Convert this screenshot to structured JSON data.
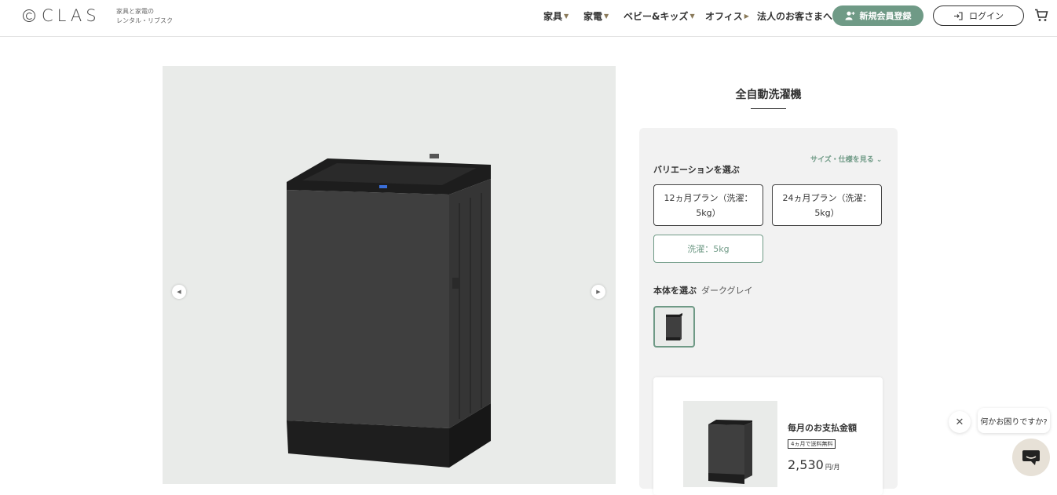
{
  "header": {
    "logo_text": "CLAS",
    "tagline_line1": "家具と家電の",
    "tagline_line2": "レンタル・リブスク",
    "nav": [
      {
        "label": "家具"
      },
      {
        "label": "家電"
      },
      {
        "label": "ベビー&キッズ"
      },
      {
        "label": "オフィス"
      },
      {
        "label": "法人のお客さまへ"
      }
    ],
    "register_label": "新規会員登録",
    "login_label": "ログイン"
  },
  "product": {
    "title": "全自動洗濯機",
    "spec_link": "サイズ・仕様を見る",
    "variation_label": "バリエーションを選ぶ",
    "variants": [
      {
        "label": "12ヵ月プラン（洗濯：5kg）"
      },
      {
        "label": "24ヵ月プラン（洗濯：5kg）"
      },
      {
        "label": "洗濯：5kg"
      }
    ],
    "selected_variant_index": 2,
    "body_label": "本体を選ぶ",
    "body_color": "ダークグレイ",
    "payment_label": "毎月のお支払金額",
    "shipping_badge": "4ヵ月で送料無料",
    "price": "2,530",
    "price_unit": "円/月"
  },
  "chat": {
    "prompt": "何かお困りですか?"
  },
  "colors": {
    "accent": "#6f9a86",
    "image_bg": "#e9ebe9",
    "panel_bg": "#f2f2f2"
  }
}
